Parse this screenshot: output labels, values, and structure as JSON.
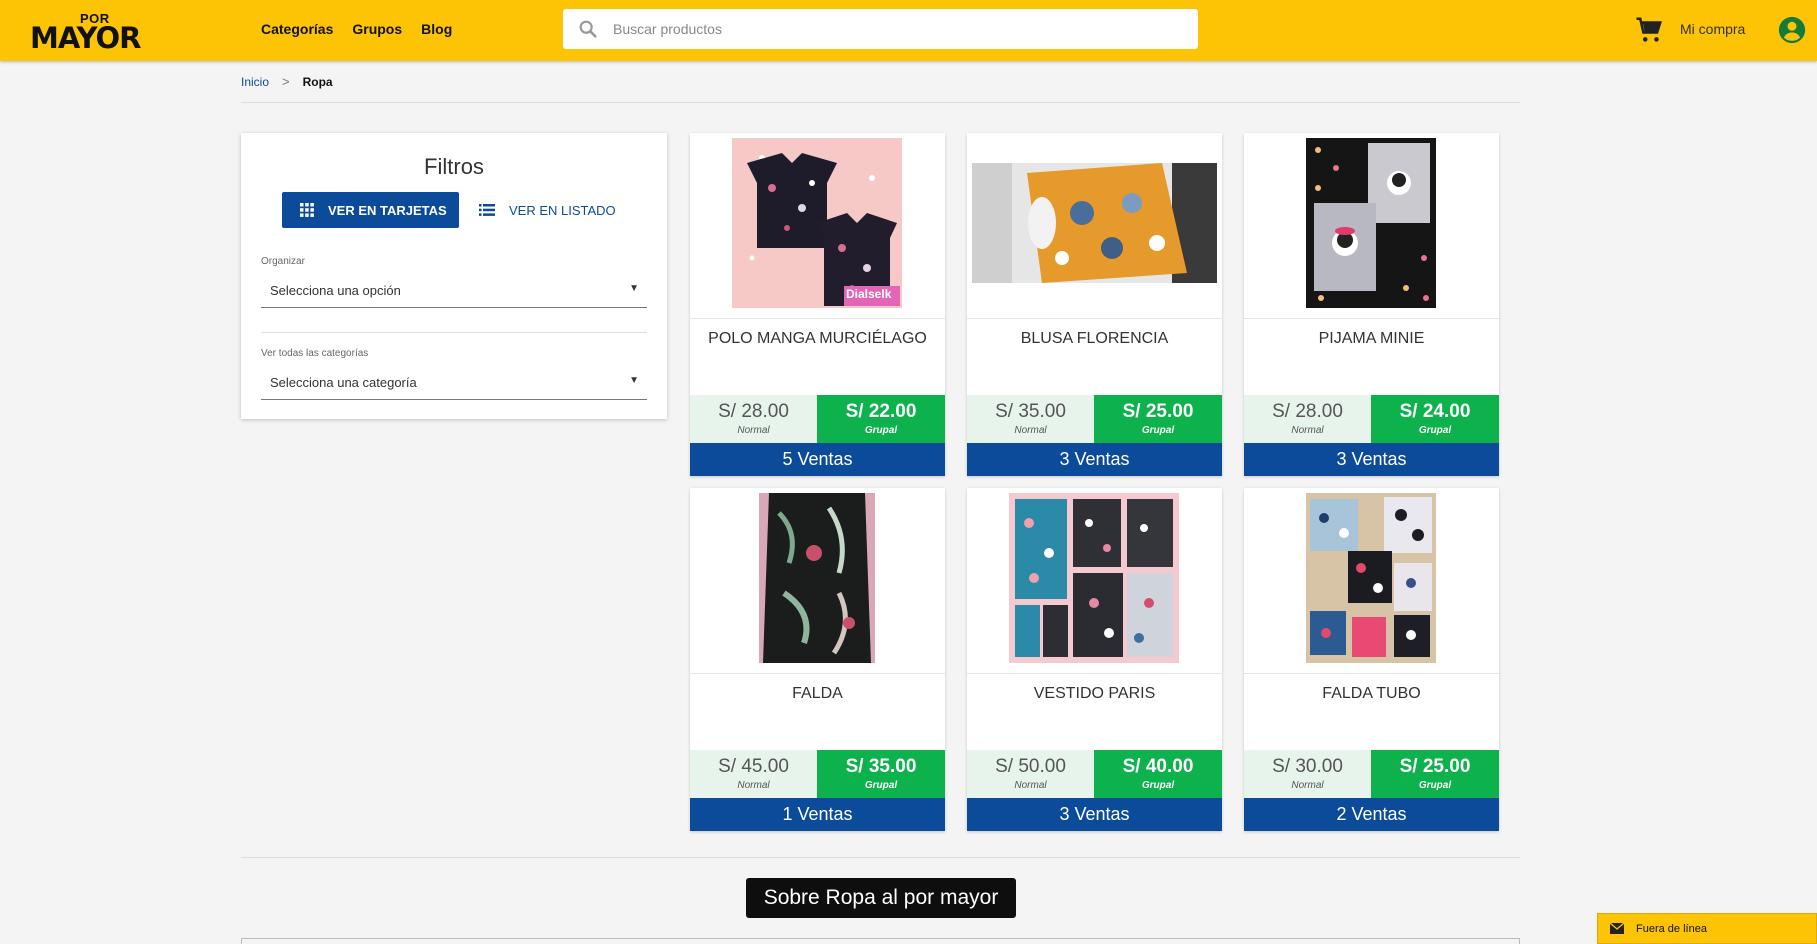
{
  "header": {
    "logo_top": "POR",
    "logo_bottom": "MAYOR",
    "nav": [
      "Categorías",
      "Grupos",
      "Blog"
    ],
    "search_placeholder": "Buscar productos",
    "cart_label": "Mi compra",
    "brand_color": "#fcc405"
  },
  "breadcrumb": {
    "home": "Inicio",
    "separator": ">",
    "current": "Ropa"
  },
  "filters": {
    "title": "Filtros",
    "view_cards": "VER EN TARJETAS",
    "view_list": "VER EN LISTADO",
    "sort_label": "Organizar",
    "sort_value": "Selecciona una opción",
    "category_label": "Ver todas las categorías",
    "category_value": "Selecciona una categoría"
  },
  "products": [
    {
      "name": "POLO MANGA MURCIÉLAGO",
      "normal_price": "S/ 28.00",
      "normal_label": "Normal",
      "group_price": "S/ 22.00",
      "group_label": "Grupal",
      "sales": "5 Ventas",
      "badge": "Dialselk"
    },
    {
      "name": "BLUSA FLORENCIA",
      "normal_price": "S/ 35.00",
      "normal_label": "Normal",
      "group_price": "S/ 25.00",
      "group_label": "Grupal",
      "sales": "3 Ventas"
    },
    {
      "name": "PIJAMA MINIE",
      "normal_price": "S/ 28.00",
      "normal_label": "Normal",
      "group_price": "S/ 24.00",
      "group_label": "Grupal",
      "sales": "3 Ventas"
    },
    {
      "name": "FALDA",
      "normal_price": "S/ 45.00",
      "normal_label": "Normal",
      "group_price": "S/ 35.00",
      "group_label": "Grupal",
      "sales": "1 Ventas"
    },
    {
      "name": "VESTIDO PARIS",
      "normal_price": "S/ 50.00",
      "normal_label": "Normal",
      "group_price": "S/ 40.00",
      "group_label": "Grupal",
      "sales": "3 Ventas"
    },
    {
      "name": "FALDA TUBO",
      "normal_price": "S/ 30.00",
      "normal_label": "Normal",
      "group_price": "S/ 25.00",
      "group_label": "Grupal",
      "sales": "2 Ventas"
    }
  ],
  "about": "Sobre Ropa al por mayor",
  "chat": "Fuera de línea",
  "colors": {
    "accent_blue": "#0c4a9a",
    "group_green": "#0db24c",
    "normal_bg": "#e7f4ec"
  },
  "icons": [
    "search-icon",
    "cart-icon",
    "user-icon",
    "grid-icon",
    "list-icon",
    "mail-icon"
  ]
}
